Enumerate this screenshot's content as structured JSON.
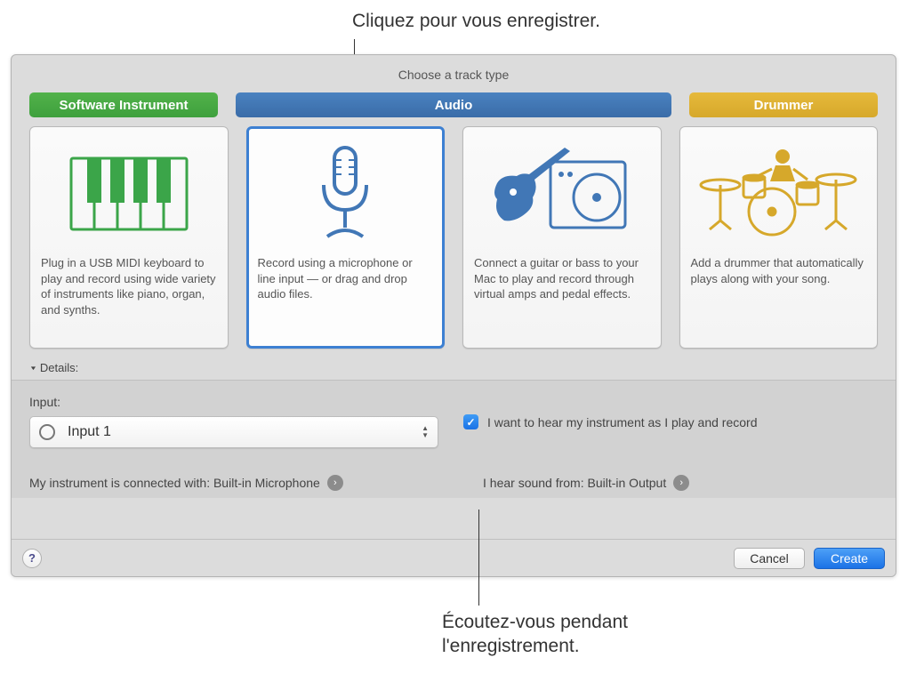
{
  "callouts": {
    "top": "Cliquez pour vous enregistrer.",
    "bottom_line1": "Écoutez-vous pendant",
    "bottom_line2": "l'enregistrement."
  },
  "header": {
    "title": "Choose a track type"
  },
  "tabs": {
    "software": "Software Instrument",
    "audio": "Audio",
    "drummer": "Drummer"
  },
  "cards": {
    "software": "Plug in a USB MIDI keyboard to play and record using wide variety of instruments like piano, organ, and synths.",
    "mic": "Record using a microphone or line input — or drag and drop audio files.",
    "guitar": "Connect a guitar or bass to your Mac to play and record through virtual amps and pedal effects.",
    "drummer": "Add a drummer that automatically plays along with your song."
  },
  "details": {
    "label": "Details:"
  },
  "input": {
    "label": "Input:",
    "value": "Input 1",
    "instrument_text": "My instrument is connected with: Built-in Microphone",
    "monitor_label": "I want to hear my instrument as I play and record",
    "output_text": "I hear sound from: Built-in Output"
  },
  "footer": {
    "cancel": "Cancel",
    "create": "Create"
  }
}
